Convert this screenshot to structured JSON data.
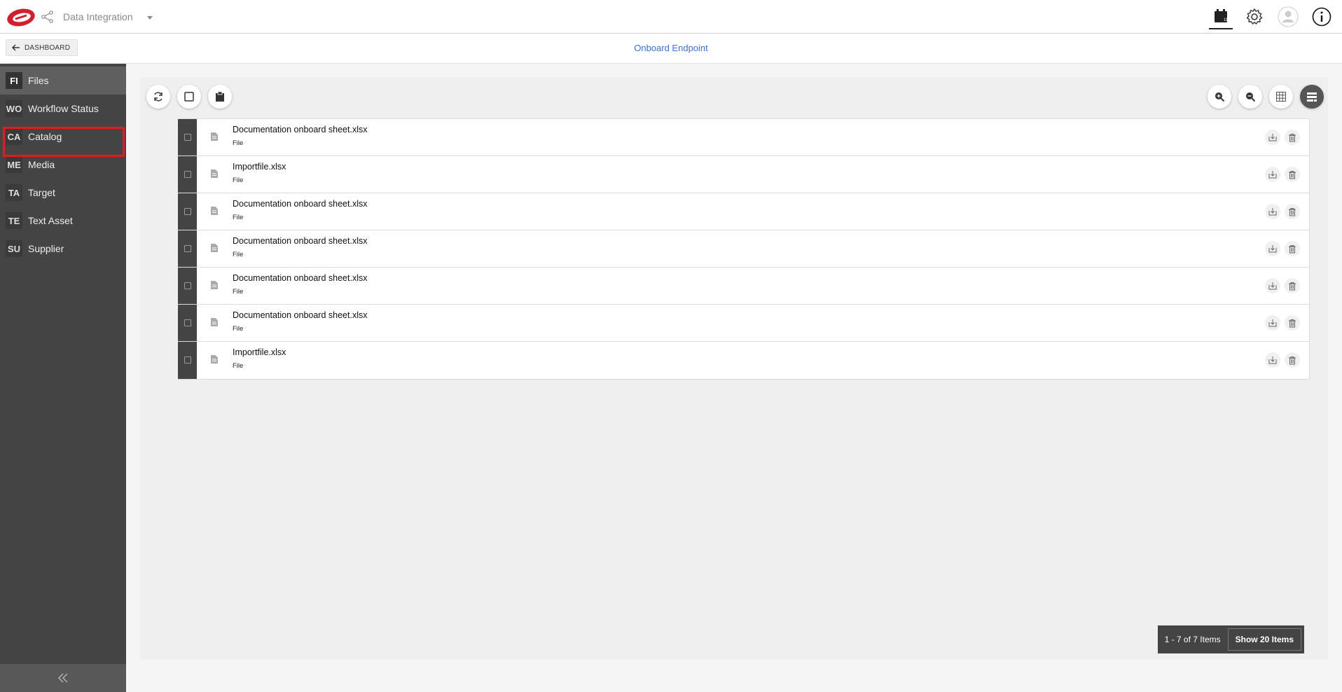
{
  "header": {
    "app_title": "Data Integration",
    "icons": [
      "logo",
      "network-icon",
      "calendar-icon",
      "gear-icon",
      "user-icon",
      "info-icon"
    ]
  },
  "subheader": {
    "dashboard_label": "DASHBOARD",
    "page_title": "Onboard Endpoint"
  },
  "sidebar": {
    "items": [
      {
        "abbr": "FI",
        "label": "Files"
      },
      {
        "abbr": "WO",
        "label": "Workflow Status"
      },
      {
        "abbr": "CA",
        "label": "Catalog"
      },
      {
        "abbr": "ME",
        "label": "Media"
      },
      {
        "abbr": "TA",
        "label": "Target"
      },
      {
        "abbr": "TE",
        "label": "Text Asset"
      },
      {
        "abbr": "SU",
        "label": "Supplier"
      }
    ]
  },
  "files": {
    "rows": [
      {
        "name": "Documentation onboard sheet.xlsx",
        "type": "File"
      },
      {
        "name": "Importfile.xlsx",
        "type": "File"
      },
      {
        "name": "Documentation onboard sheet.xlsx",
        "type": "File"
      },
      {
        "name": "Documentation onboard sheet.xlsx",
        "type": "File"
      },
      {
        "name": "Documentation onboard sheet.xlsx",
        "type": "File"
      },
      {
        "name": "Documentation onboard sheet.xlsx",
        "type": "File"
      },
      {
        "name": "Importfile.xlsx",
        "type": "File"
      }
    ]
  },
  "pager": {
    "info": "1 - 7 of 7 Items",
    "show_label": "Show 20 Items"
  },
  "colors": {
    "accent": "#3b6fd6",
    "sidebar": "#444444",
    "highlight": "#e01b24",
    "brand": "#d0202e"
  }
}
